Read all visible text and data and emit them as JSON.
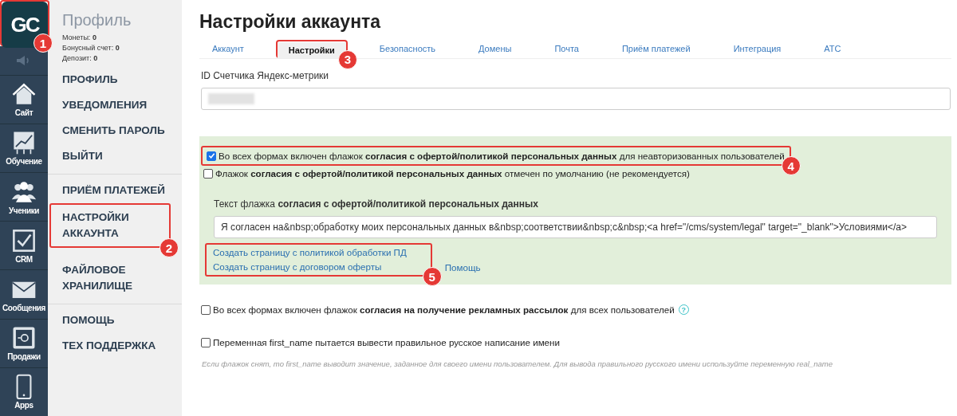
{
  "logo": {
    "text": "GC",
    "marker": "1"
  },
  "nav": [
    {
      "label": "Сайт",
      "kind": "house"
    },
    {
      "label": "Обучение",
      "kind": "chart"
    },
    {
      "label": "Ученики",
      "kind": "people"
    },
    {
      "label": "CRM",
      "kind": "check"
    },
    {
      "label": "Сообщения",
      "kind": "envelope"
    },
    {
      "label": "Продажи",
      "kind": "safe"
    },
    {
      "label": "Apps",
      "kind": "phone"
    }
  ],
  "profile": {
    "title": "Профиль",
    "balances": [
      {
        "label": "Монеты:",
        "value": "0"
      },
      {
        "label": "Бонусный счет:",
        "value": "0"
      },
      {
        "label": "Депозит:",
        "value": "0"
      }
    ]
  },
  "menu_groups": [
    [
      {
        "label": "ПРОФИЛЬ"
      },
      {
        "label": "УВЕДОМЛЕНИЯ"
      },
      {
        "label": "СМЕНИТЬ ПАРОЛЬ"
      },
      {
        "label": "ВЫЙТИ"
      }
    ],
    [
      {
        "label": "ПРИЁМ ПЛАТЕЖЕЙ"
      },
      {
        "label": "НАСТРОЙКИ АККАУНТА",
        "marker": "2"
      },
      {
        "label": "ФАЙЛОВОЕ ХРАНИЛИЩЕ"
      }
    ],
    [
      {
        "label": "ПОМОЩЬ"
      },
      {
        "label": "ТЕХ ПОДДЕРЖКА"
      }
    ]
  ],
  "page_title": "Настройки аккаунта",
  "tabs": [
    {
      "label": "Аккаунт",
      "selected": false
    },
    {
      "label": "Настройки",
      "selected": true,
      "marker": "3"
    },
    {
      "label": "Безопасность",
      "selected": false
    },
    {
      "label": "Домены",
      "selected": false
    },
    {
      "label": "Почта",
      "selected": false
    },
    {
      "label": "Приём платежей",
      "selected": false
    },
    {
      "label": "Интеграция",
      "selected": false
    },
    {
      "label": "АТС",
      "selected": false
    }
  ],
  "metrika_field": {
    "label": "ID Счетчика Яндекс-метрики"
  },
  "consent_panel": {
    "options": [
      {
        "text": "Во всех формах включен флажок **согласия с офертой/политикой персональных данных** для неавторизованных пользователей",
        "checked": true,
        "marker": "4"
      },
      {
        "text": "Флажок **согласия с офертой/политикой персональных данных** отмечен по умолчанию (не рекомендуется)",
        "checked": false
      }
    ],
    "text_field": {
      "label": "Текст флажка **согласия с офертой/политикой персональных данных**",
      "value": "Я согласен на&nbsp;обработку моих персональных данных в&nbsp;соответствии&nbsp;с&nbsp;<a href=\"/cms/system/legal\" target=\"_blank\">Условиями</a>"
    },
    "links": [
      "Создать страницу с политикой обработки ПД",
      "Создать страницу с договором оферты"
    ],
    "links_marker": "5",
    "help_link": "Помощь"
  },
  "options": [
    {
      "text": "Во всех формах включен флажок **согласия на получение рекламных рассылок** для всех пользователей",
      "checked": false,
      "help": "?"
    },
    {
      "text": "Переменная first_name пытается вывести правильное русское написание имени",
      "checked": false,
      "hint": "Если флажок снят, то first_name выводит значение, заданное для своего имени пользователем. Для вывода правильного русского имени используйте переменную real_name"
    }
  ]
}
